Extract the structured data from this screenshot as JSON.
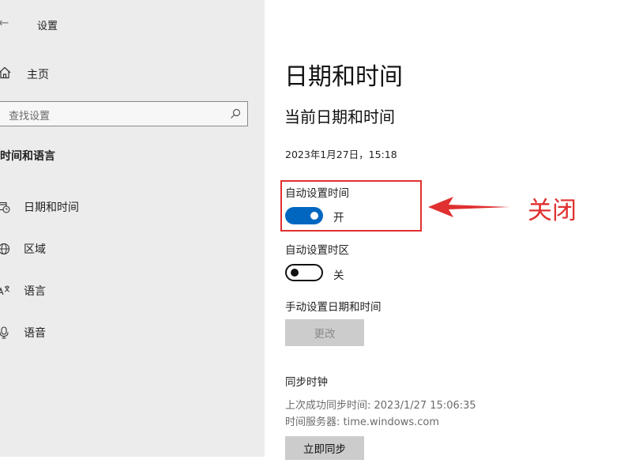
{
  "window": {
    "title": "设置"
  },
  "sidebar": {
    "home_label": "主页",
    "search_placeholder": "查找设置",
    "section_header": "时间和语言",
    "items": [
      {
        "label": "日期和时间",
        "icon": "calendar-clock-icon"
      },
      {
        "label": "区域",
        "icon": "globe-icon"
      },
      {
        "label": "语言",
        "icon": "language-icon"
      },
      {
        "label": "语音",
        "icon": "microphone-icon"
      }
    ]
  },
  "main": {
    "title": "日期和时间",
    "section_title": "当前日期和时间",
    "current_datetime": "2023年1月27日，15:18",
    "auto_time": {
      "label": "自动设置时间",
      "state": "开"
    },
    "auto_timezone": {
      "label": "自动设置时区",
      "state": "关"
    },
    "manual": {
      "label": "手动设置日期和时间",
      "button": "更改"
    },
    "sync": {
      "header": "同步时钟",
      "last_sync": "上次成功同步时间: 2023/1/27 15:06:35",
      "server": "时间服务器: time.windows.com",
      "button": "立即同步"
    }
  },
  "annotation": {
    "text": "关闭",
    "color": "#e03030"
  },
  "colors": {
    "toggle_on": "#0067c0",
    "sidebar_bg": "#ececec"
  }
}
